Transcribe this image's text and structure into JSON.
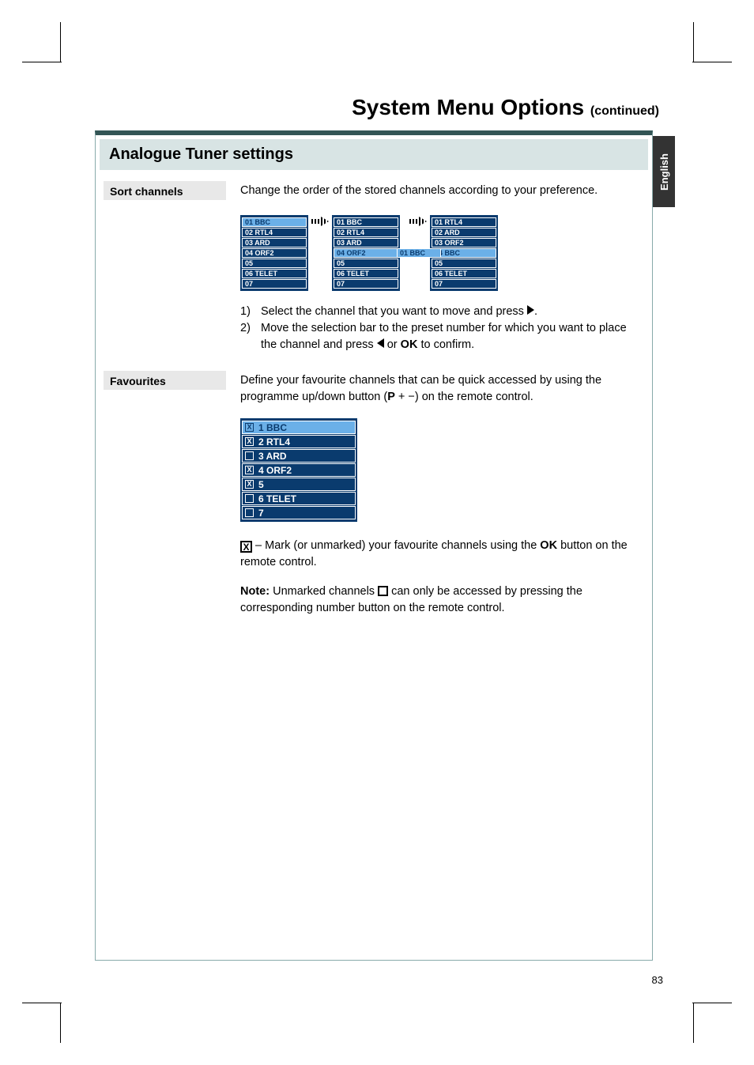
{
  "title": {
    "main": "System Menu Options",
    "suffix": "(continued)"
  },
  "side_tab": "English",
  "section_header": "Analogue Tuner settings",
  "sort": {
    "label": "Sort channels",
    "intro": "Change the order of the stored channels according to your preference.",
    "box1": [
      "01  BBC",
      "02  RTL4",
      "03  ARD",
      "04  ORF2",
      "05",
      "06  TELET",
      "07"
    ],
    "box1_hl": 0,
    "box2": [
      "01  BBC",
      "02  RTL4",
      "03  ARD",
      "04  ORF2",
      "05",
      "06  TELET",
      "07"
    ],
    "box2_hl": 3,
    "box2_float": "01  BBC",
    "box3": [
      "01  RTL4",
      "02  ARD",
      "03  ORF2",
      "04  BBC",
      "05",
      "06  TELET",
      "07"
    ],
    "box3_hl": 3,
    "step1_n": "1)",
    "step1": "Select the channel that you want to move and press ",
    "step1_end": ".",
    "step2_n": "2)",
    "step2a": "Move the selection bar to the preset number for which you want to place the channel and press ",
    "step2b": " or ",
    "step2_ok": "OK",
    "step2c": " to confirm."
  },
  "fav": {
    "label": "Favourites",
    "intro_a": "Define your favourite channels that can be quick accessed by using the programme up/down button (",
    "intro_p": "P",
    "intro_pm": " + −",
    "intro_b": ") on the remote control.",
    "list": [
      {
        "chk": true,
        "txt": "1  BBC",
        "hl": true
      },
      {
        "chk": true,
        "txt": "2  RTL4",
        "hl": false
      },
      {
        "chk": false,
        "txt": "3  ARD",
        "hl": false
      },
      {
        "chk": true,
        "txt": "4  ORF2",
        "hl": false
      },
      {
        "chk": true,
        "txt": "5",
        "hl": false
      },
      {
        "chk": false,
        "txt": "6  TELET",
        "hl": false
      },
      {
        "chk": false,
        "txt": "7",
        "hl": false
      }
    ],
    "mark_a": " –  Mark (or unmarked) your favourite channels using the ",
    "mark_ok": "OK",
    "mark_b": " button on the remote control.",
    "note_label": "Note:",
    "note_a": "  Unmarked channels ",
    "note_b": " can only be accessed by pressing the corresponding number button on the remote control."
  },
  "page_number": "83"
}
